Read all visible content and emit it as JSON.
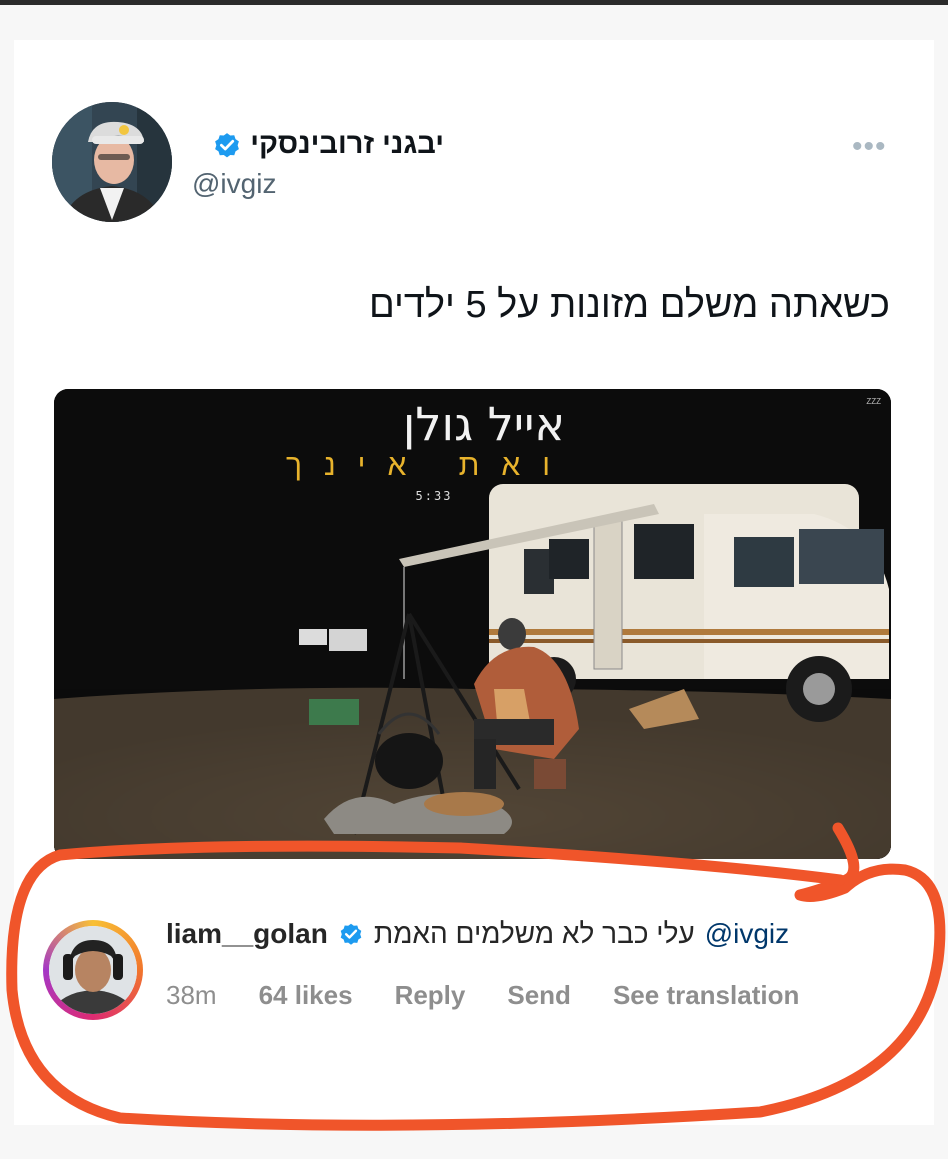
{
  "tweet": {
    "display_name": "יבגני זרובינסקי",
    "handle": "@ivgiz",
    "more_label": "•••",
    "text": "כשאתה משלם מזונות על 5 ילדים",
    "media": {
      "title": "אייל גולן",
      "subtitle": "ואת אינך",
      "time": "5:33",
      "corner_tag": "ZZZ"
    }
  },
  "comment": {
    "username": "liam__golan",
    "mention": "@ivgiz",
    "text": "עלי כבר לא משלמים האמת",
    "time": "38m",
    "likes": "64 likes",
    "reply_label": "Reply",
    "send_label": "Send",
    "translate_label": "See translation"
  },
  "colors": {
    "verified_blue": "#1d9bf0",
    "annotation_red": "#f0552a",
    "mention_blue": "#00376b"
  },
  "icons": {
    "verified": "verified-badge-icon",
    "more": "more-options-icon"
  }
}
